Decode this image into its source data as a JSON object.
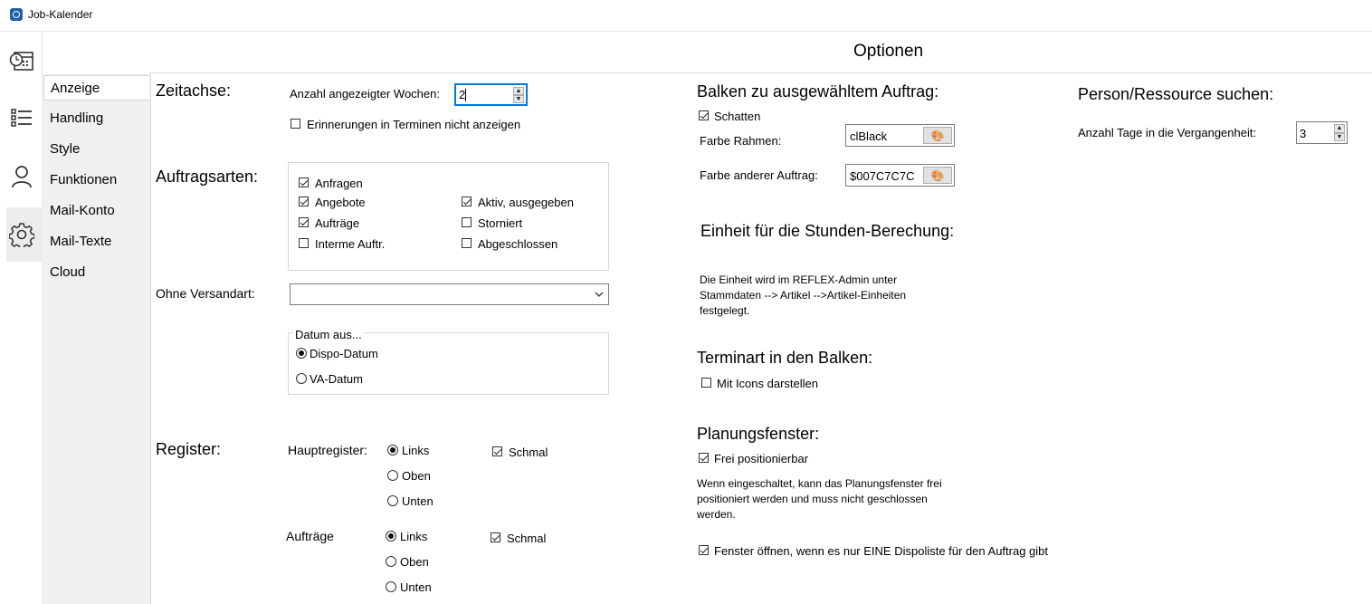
{
  "window": {
    "title": "Job-Kalender"
  },
  "page": {
    "title": "Optionen"
  },
  "nav": {
    "items": [
      {
        "label": "Anzeige"
      },
      {
        "label": "Handling"
      },
      {
        "label": "Style"
      },
      {
        "label": "Funktionen"
      },
      {
        "label": "Mail-Konto"
      },
      {
        "label": "Mail-Texte"
      },
      {
        "label": "Cloud"
      }
    ],
    "selected": "Anzeige"
  },
  "rail": {
    "icons": [
      "calendar-clock-icon",
      "list-icon",
      "person-icon",
      "gear-icon"
    ],
    "selected": "gear-icon"
  },
  "zeitachse": {
    "heading": "Zeitachse:",
    "weeks_label": "Anzahl angezeigter Wochen:",
    "weeks_value": "2",
    "hide_reminders_label": "Erinnerungen in Terminen nicht anzeigen"
  },
  "auftragsarten": {
    "heading": "Auftragsarten:",
    "items": [
      {
        "label": "Anfragen",
        "checked": true
      },
      {
        "label": "Angebote",
        "checked": true
      },
      {
        "label": "Aufträge",
        "checked": true
      },
      {
        "label": "Interme Auftr.",
        "checked": false
      },
      {
        "label": "Aktiv, ausgegeben",
        "checked": true
      },
      {
        "label": "Storniert",
        "checked": false
      },
      {
        "label": "Abgeschlossen",
        "checked": false
      }
    ]
  },
  "versandart": {
    "label": "Ohne Versandart:",
    "value": ""
  },
  "datum": {
    "legend": "Datum aus...",
    "options": [
      {
        "label": "Dispo-Datum",
        "selected": true
      },
      {
        "label": "VA-Datum",
        "selected": false
      }
    ]
  },
  "register": {
    "heading": "Register:",
    "haupt_label": "Hauptregister:",
    "auftraege_label": "Aufträge",
    "options": [
      "Links",
      "Oben",
      "Unten"
    ],
    "haupt_selected": "Links",
    "auftraege_selected": "Links",
    "schmal_label": "Schmal",
    "haupt_schmal": true,
    "auftraege_schmal": true
  },
  "balken": {
    "heading": "Balken zu ausgewähltem Auftrag:",
    "schatten_label": "Schatten",
    "schatten": true,
    "rahmen_label": "Farbe Rahmen:",
    "rahmen_value": "clBlack",
    "anderer_label": "Farbe anderer Auftrag:",
    "anderer_value": "$007C7C7C"
  },
  "einheit": {
    "heading": "Einheit für die Stunden-Berechung:",
    "text": "Die Einheit wird im REFLEX-Admin unter Stammdaten --> Artikel -->Artikel-Einheiten festgelegt."
  },
  "terminart": {
    "heading": "Terminart in den Balken:",
    "icons_label": "Mit Icons darstellen",
    "icons": false
  },
  "planung": {
    "heading": "Planungsfenster:",
    "frei_label": "Frei positionierbar",
    "frei": true,
    "text": "Wenn eingeschaltet, kann das Planungsfenster frei positioniert werden und muss nicht geschlossen werden.",
    "open_label": "Fenster öffnen, wenn es nur EINE Dispoliste für den Auftrag gibt",
    "open": true
  },
  "person": {
    "heading": "Person/Ressource suchen:",
    "days_label": "Anzahl Tage in die Vergangenheit:",
    "days_value": "3"
  }
}
